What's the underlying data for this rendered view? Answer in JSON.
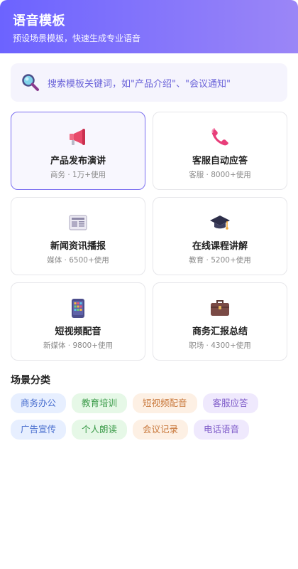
{
  "header": {
    "title": "语音模板",
    "subtitle": "预设场景模板，快速生成专业语音"
  },
  "search": {
    "icon": "magnifier-icon",
    "placeholder": "搜索模板关键词，如\"产品介绍\"、\"会议通知\""
  },
  "templates": [
    {
      "name": "产品发布演讲",
      "meta": "商务 · 1万+使用",
      "icon": "megaphone-icon",
      "active": true
    },
    {
      "name": "客服自动应答",
      "meta": "客服 · 8000+使用",
      "icon": "phone-icon",
      "active": false
    },
    {
      "name": "新闻资讯播报",
      "meta": "媒体 · 6500+使用",
      "icon": "newspaper-icon",
      "active": false
    },
    {
      "name": "在线课程讲解",
      "meta": "教育 · 5200+使用",
      "icon": "graduation-cap-icon",
      "active": false
    },
    {
      "name": "短视频配音",
      "meta": "新媒体 · 9800+使用",
      "icon": "mobile-phone-icon",
      "active": false
    },
    {
      "name": "商务汇报总结",
      "meta": "职场 · 4300+使用",
      "icon": "briefcase-icon",
      "active": false
    }
  ],
  "categories": {
    "title": "场景分类",
    "tags": [
      {
        "label": "商务办公",
        "color": "blue"
      },
      {
        "label": "教育培训",
        "color": "green"
      },
      {
        "label": "短视频配音",
        "color": "orange"
      },
      {
        "label": "客服应答",
        "color": "purple"
      },
      {
        "label": "广告宣传",
        "color": "blue"
      },
      {
        "label": "个人朗读",
        "color": "green"
      },
      {
        "label": "会议记录",
        "color": "orange"
      },
      {
        "label": "电话语音",
        "color": "purple"
      }
    ]
  },
  "colors": {
    "header_gradient_start": "#6c63ff",
    "header_gradient_end": "#9b86f7",
    "accent": "#7a6ef0"
  }
}
